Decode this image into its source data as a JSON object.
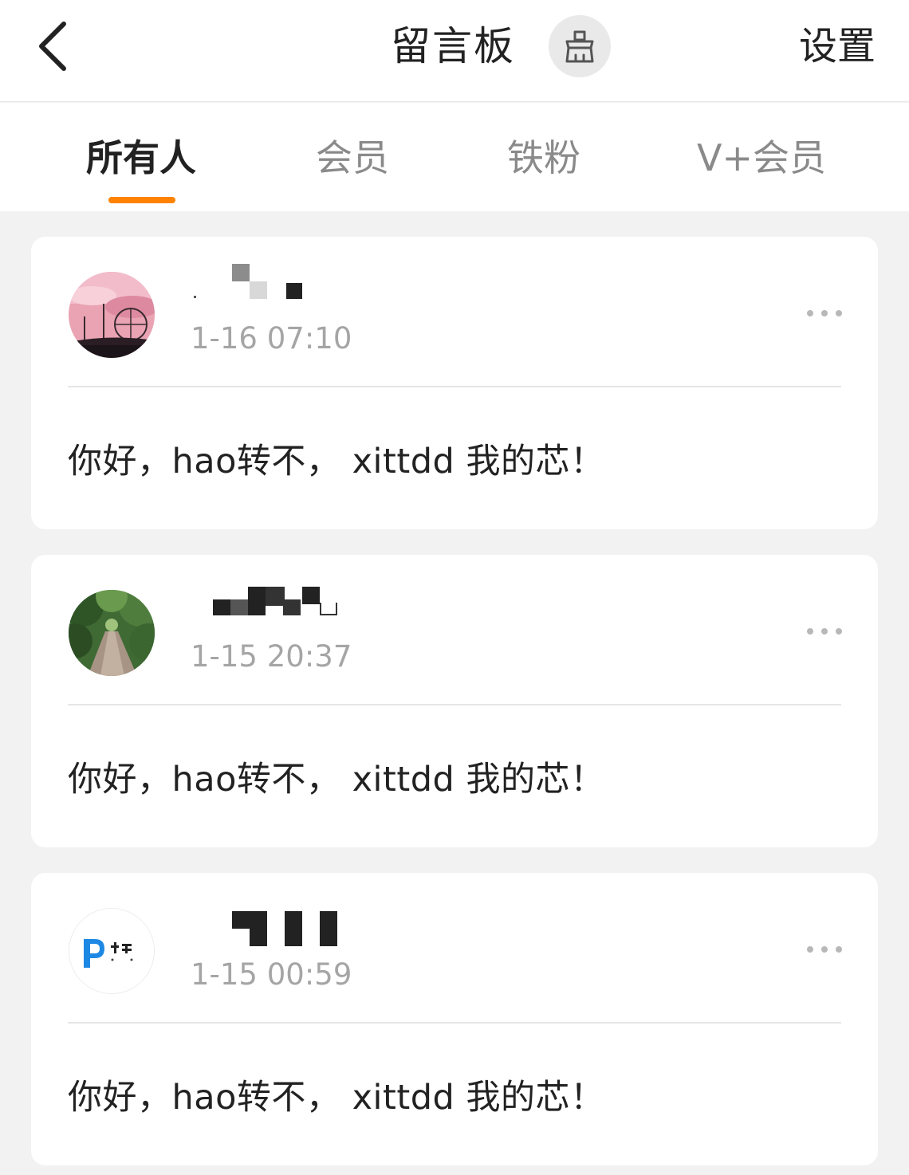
{
  "header": {
    "back_icon": "chevron-left-icon",
    "title": "留言板",
    "clean_icon": "brush-icon",
    "settings_label": "设置"
  },
  "tabs": [
    {
      "label": "所有人",
      "active": true
    },
    {
      "label": "会员",
      "active": false
    },
    {
      "label": "铁粉",
      "active": false
    },
    {
      "label": "V+会员",
      "active": false
    }
  ],
  "accent_color": "#ff8200",
  "messages": [
    {
      "time": "1-16 07:10",
      "text": "你好，hao转不， xittdd 我的芯！",
      "more_icon": "more-dots-icon"
    },
    {
      "time": "1-15 20:37",
      "text": "你好，hao转不， xittdd 我的芯！",
      "more_icon": "more-dots-icon"
    },
    {
      "time": "1-15 00:59",
      "text": "你好，hao转不， xittdd 我的芯！",
      "more_icon": "more-dots-icon"
    }
  ]
}
